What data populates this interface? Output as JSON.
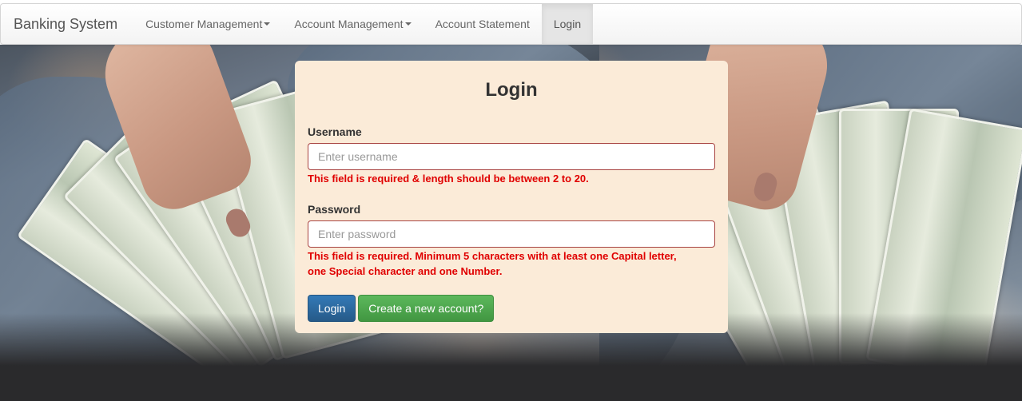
{
  "navbar": {
    "brand": "Banking System",
    "items": [
      {
        "label": "Customer Management",
        "dropdown": true
      },
      {
        "label": "Account Management",
        "dropdown": true
      },
      {
        "label": "Account Statement",
        "dropdown": false
      },
      {
        "label": "Login",
        "dropdown": false,
        "active": true
      }
    ]
  },
  "login": {
    "title": "Login",
    "username": {
      "label": "Username",
      "placeholder": "Enter username",
      "value": "",
      "error": "This field is required & length should be between 2 to 20."
    },
    "password": {
      "label": "Password",
      "placeholder": "Enter password",
      "value": "",
      "error_line1": "This field is required. Minimum 5 characters with at least one Capital letter,",
      "error_line2": "one Special character and one Number."
    },
    "login_button": "Login",
    "create_button": "Create a new account?"
  },
  "colors": {
    "card_background": "#fbebd8",
    "error_text": "#e00000",
    "primary_button": "#337ab7",
    "success_button": "#5cb85c"
  }
}
